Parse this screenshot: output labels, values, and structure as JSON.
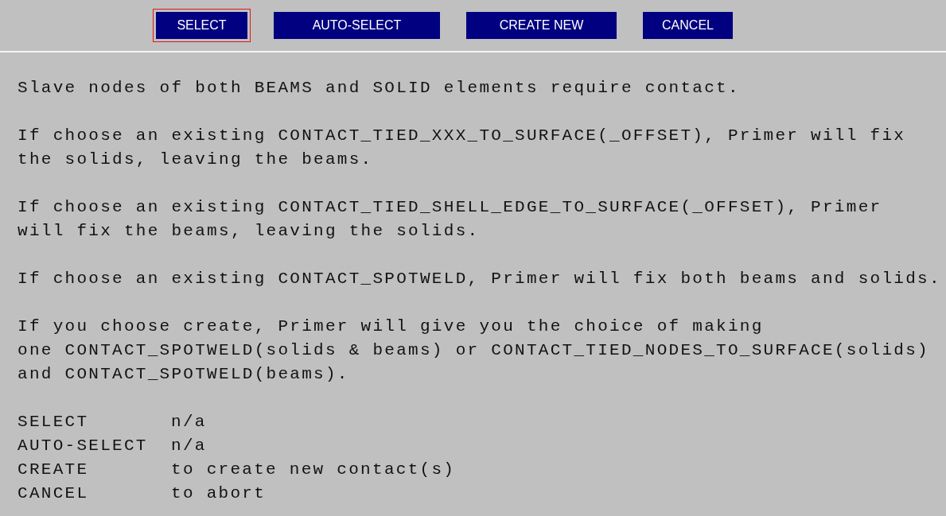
{
  "toolbar": {
    "buttons": [
      {
        "label": "SELECT",
        "selected": true
      },
      {
        "label": "AUTO-SELECT",
        "selected": false
      },
      {
        "label": "CREATE NEW",
        "selected": false
      },
      {
        "label": "CANCEL",
        "selected": false
      }
    ]
  },
  "help": {
    "paragraphs": [
      "Slave nodes of both BEAMS and SOLID elements require contact.",
      "If choose an existing CONTACT_TIED_XXX_TO_SURFACE(_OFFSET), Primer will fix\nthe solids, leaving the beams.",
      "If choose an existing CONTACT_TIED_SHELL_EDGE_TO_SURFACE(_OFFSET), Primer\nwill fix the beams, leaving the solids.",
      "If choose an existing CONTACT_SPOTWELD, Primer will fix both beams and solids.",
      "If you choose create, Primer will give you the choice of making\none CONTACT_SPOTWELD(solids & beams) or CONTACT_TIED_NODES_TO_SURFACE(solids)\nand CONTACT_SPOTWELD(beams)."
    ],
    "options": [
      {
        "option": "SELECT",
        "meaning": "n/a"
      },
      {
        "option": "AUTO-SELECT",
        "meaning": "n/a"
      },
      {
        "option": "CREATE",
        "meaning": "to create new contact(s)"
      },
      {
        "option": "CANCEL",
        "meaning": "to abort"
      }
    ]
  }
}
